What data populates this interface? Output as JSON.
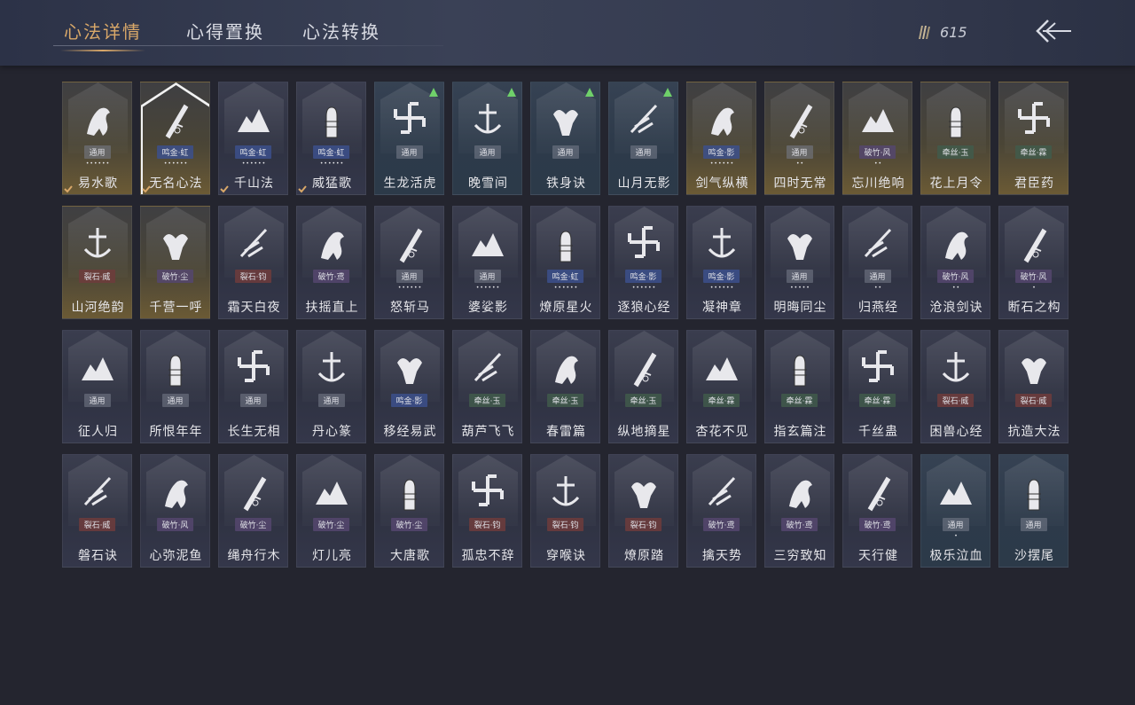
{
  "tabs": [
    "心法详情",
    "心得置换",
    "心法转换"
  ],
  "active_tab": 0,
  "currency": {
    "icon": "feather-quills-icon",
    "value": "615"
  },
  "back_icon": "back-arrow-icon",
  "colors": {
    "accent": "#d9a869",
    "upgrade_arrow": "#6fd06a",
    "background": "#24252f"
  },
  "cards": [
    {
      "name": "易水歌",
      "tag": "通用",
      "stars": "••••••",
      "style": "gold",
      "arrow": false,
      "check": true,
      "icon": "horse-icon"
    },
    {
      "name": "无名心法",
      "tag": "鸣金·虹",
      "stars": "••••••",
      "style": "gold",
      "arrow": false,
      "check": true,
      "icon": "sword-icon",
      "selected": true
    },
    {
      "name": "千山法",
      "tag": "鸣金·虹",
      "stars": "••••••",
      "style": "",
      "arrow": false,
      "check": true,
      "icon": "mountains-icon"
    },
    {
      "name": "威猛歌",
      "tag": "鸣金·虹",
      "stars": "••••••",
      "style": "",
      "arrow": false,
      "check": true,
      "icon": "fist-icon"
    },
    {
      "name": "生龙活虎",
      "tag": "通用",
      "stars": "",
      "style": "blue",
      "arrow": true,
      "check": false,
      "icon": "swastika-icon"
    },
    {
      "name": "晚雪间",
      "tag": "通用",
      "stars": "",
      "style": "blue",
      "arrow": true,
      "check": false,
      "icon": "anchor-icon"
    },
    {
      "name": "铁身诀",
      "tag": "通用",
      "stars": "",
      "style": "blue",
      "arrow": true,
      "check": false,
      "icon": "muscle-icon"
    },
    {
      "name": "山月无影",
      "tag": "通用",
      "stars": "",
      "style": "blue",
      "arrow": true,
      "check": false,
      "icon": "slash-icon"
    },
    {
      "name": "剑气纵横",
      "tag": "鸣金·影",
      "stars": "••••••",
      "style": "gold",
      "arrow": false,
      "check": false,
      "icon": "crossed-blades-icon"
    },
    {
      "name": "四时无常",
      "tag": "通用",
      "stars": "••",
      "style": "gold",
      "arrow": false,
      "check": false,
      "icon": "wave-icon"
    },
    {
      "name": "忘川绝响",
      "tag": "破竹·风",
      "stars": "••",
      "style": "gold",
      "arrow": false,
      "check": false,
      "icon": "mask-icon"
    },
    {
      "name": "花上月令",
      "tag": "牵丝·玉",
      "stars": "",
      "style": "gold",
      "arrow": false,
      "check": false,
      "icon": "flower-moon-icon"
    },
    {
      "name": "君臣药",
      "tag": "牵丝·霖",
      "stars": "",
      "style": "gold",
      "arrow": false,
      "check": false,
      "icon": "bowl-icon"
    },
    {
      "name": "山河绝韵",
      "tag": "裂石·威",
      "stars": "",
      "style": "gold",
      "arrow": false,
      "check": false,
      "icon": "river-mountains-icon"
    },
    {
      "name": "千营一呼",
      "tag": "破竹·尘",
      "stars": "",
      "style": "gold",
      "arrow": false,
      "check": false,
      "icon": "flag-icon"
    },
    {
      "name": "霜天白夜",
      "tag": "裂石·钧",
      "stars": "",
      "style": "",
      "arrow": false,
      "check": false,
      "icon": "spear-icon"
    },
    {
      "name": "扶摇直上",
      "tag": "破竹·鸢",
      "stars": "",
      "style": "",
      "arrow": false,
      "check": false,
      "icon": "eagle-icon"
    },
    {
      "name": "怒斩马",
      "tag": "通用",
      "stars": "••••••",
      "style": "",
      "arrow": false,
      "check": false,
      "icon": "blade-icon"
    },
    {
      "name": "婆娑影",
      "tag": "通用",
      "stars": "••••••",
      "style": "",
      "arrow": false,
      "check": false,
      "icon": "dragon-icon"
    },
    {
      "name": "燎原星火",
      "tag": "鸣金·虹",
      "stars": "••••••",
      "style": "",
      "arrow": false,
      "check": false,
      "icon": "scythe-icon"
    },
    {
      "name": "逐狼心经",
      "tag": "鸣金·影",
      "stars": "••••••",
      "style": "",
      "arrow": false,
      "check": false,
      "icon": "wolf-icon"
    },
    {
      "name": "凝神章",
      "tag": "鸣金·影",
      "stars": "••••••",
      "style": "",
      "arrow": false,
      "check": false,
      "icon": "bow-icon"
    },
    {
      "name": "明晦同尘",
      "tag": "通用",
      "stars": "•••••",
      "style": "",
      "arrow": false,
      "check": false,
      "icon": "knot-icon"
    },
    {
      "name": "归燕经",
      "tag": "通用",
      "stars": "••",
      "style": "",
      "arrow": false,
      "check": false,
      "icon": "swallow-icon"
    },
    {
      "name": "沧浪剑诀",
      "tag": "破竹·风",
      "stars": "••",
      "style": "",
      "arrow": false,
      "check": false,
      "icon": "serpent-icon"
    },
    {
      "name": "断石之构",
      "tag": "破竹·风",
      "stars": "•",
      "style": "",
      "arrow": false,
      "check": false,
      "icon": "warrior-icon"
    },
    {
      "name": "征人归",
      "tag": "通用",
      "stars": "",
      "style": "",
      "arrow": false,
      "check": false,
      "icon": "bird-hand-icon"
    },
    {
      "name": "所恨年年",
      "tag": "通用",
      "stars": "",
      "style": "",
      "arrow": false,
      "check": false,
      "icon": "bamboo-icon"
    },
    {
      "name": "长生无相",
      "tag": "通用",
      "stars": "",
      "style": "",
      "arrow": false,
      "check": false,
      "icon": "meditation-icon"
    },
    {
      "name": "丹心篆",
      "tag": "通用",
      "stars": "",
      "style": "",
      "arrow": false,
      "check": false,
      "icon": "brush-icon"
    },
    {
      "name": "移经易武",
      "tag": "鸣金·影",
      "stars": "",
      "style": "",
      "arrow": false,
      "check": false,
      "icon": "armor-icon"
    },
    {
      "name": "葫芦飞飞",
      "tag": "牵丝·玉",
      "stars": "",
      "style": "",
      "arrow": false,
      "check": false,
      "icon": "gourd-icon"
    },
    {
      "name": "春雷篇",
      "tag": "牵丝·玉",
      "stars": "",
      "style": "",
      "arrow": false,
      "check": false,
      "icon": "storm-icon"
    },
    {
      "name": "纵地摘星",
      "tag": "牵丝·玉",
      "stars": "",
      "style": "",
      "arrow": false,
      "check": false,
      "icon": "hand-star-icon"
    },
    {
      "name": "杏花不见",
      "tag": "牵丝·霖",
      "stars": "",
      "style": "",
      "arrow": false,
      "check": false,
      "icon": "blossom-icon"
    },
    {
      "name": "指玄篇注",
      "tag": "牵丝·霖",
      "stars": "",
      "style": "",
      "arrow": false,
      "check": false,
      "icon": "yin-yang-icon"
    },
    {
      "name": "千丝蛊",
      "tag": "牵丝·霖",
      "stars": "",
      "style": "",
      "arrow": false,
      "check": false,
      "icon": "leaf-icon"
    },
    {
      "name": "困兽心经",
      "tag": "裂石·威",
      "stars": "",
      "style": "",
      "arrow": false,
      "check": false,
      "icon": "shackle-icon"
    },
    {
      "name": "抗造大法",
      "tag": "裂石·威",
      "stars": "",
      "style": "",
      "arrow": false,
      "check": false,
      "icon": "bell-icon"
    },
    {
      "name": "磐石诀",
      "tag": "裂石·威",
      "stars": "",
      "style": "",
      "arrow": false,
      "check": false,
      "icon": "boulder-icon"
    },
    {
      "name": "心弥泥鱼",
      "tag": "破竹·风",
      "stars": "",
      "style": "",
      "arrow": false,
      "check": false,
      "icon": "fish-icon"
    },
    {
      "name": "绳舟行木",
      "tag": "破竹·尘",
      "stars": "",
      "style": "",
      "arrow": false,
      "check": false,
      "icon": "roots-icon"
    },
    {
      "name": "灯儿亮",
      "tag": "破竹·尘",
      "stars": "",
      "style": "",
      "arrow": false,
      "check": false,
      "icon": "lantern-icon"
    },
    {
      "name": "大唐歌",
      "tag": "破竹·尘",
      "stars": "",
      "style": "",
      "arrow": false,
      "check": false,
      "icon": "city-icon"
    },
    {
      "name": "孤忠不辞",
      "tag": "裂石·钧",
      "stars": "",
      "style": "",
      "arrow": false,
      "check": false,
      "icon": "broken-blade-icon"
    },
    {
      "name": "穿喉诀",
      "tag": "裂石·钧",
      "stars": "",
      "style": "",
      "arrow": false,
      "check": false,
      "icon": "pierce-icon"
    },
    {
      "name": "燎原踏",
      "tag": "裂石·钧",
      "stars": "",
      "style": "",
      "arrow": false,
      "check": false,
      "icon": "rider-icon"
    },
    {
      "name": "擒天势",
      "tag": "破竹·鸢",
      "stars": "",
      "style": "",
      "arrow": false,
      "check": false,
      "icon": "chain-fist-icon"
    },
    {
      "name": "三穷致知",
      "tag": "破竹·鸢",
      "stars": "",
      "style": "",
      "arrow": false,
      "check": false,
      "icon": "scroll-icon"
    },
    {
      "name": "天行健",
      "tag": "破竹·鸢",
      "stars": "",
      "style": "",
      "arrow": false,
      "check": false,
      "icon": "hat-icon"
    },
    {
      "name": "极乐泣血",
      "tag": "通用",
      "stars": "•",
      "style": "blue",
      "arrow": false,
      "check": false,
      "icon": "crescent-slash-icon"
    },
    {
      "name": "沙摆尾",
      "tag": "通用",
      "stars": "",
      "style": "blue",
      "arrow": false,
      "check": false,
      "icon": "swirl-icon"
    }
  ]
}
